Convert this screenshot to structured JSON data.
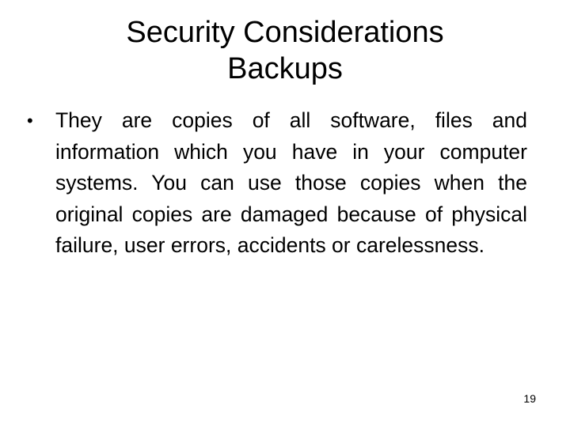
{
  "slide": {
    "title_line1": "Security Considerations",
    "title_line2": "Backups",
    "bullets": [
      {
        "marker": "•",
        "text": "They are copies of all software, files and information which you have in your computer systems. You can use those copies when the original copies are damaged because of physical failure, user errors, accidents or carelessness."
      }
    ],
    "page_number": "19"
  }
}
